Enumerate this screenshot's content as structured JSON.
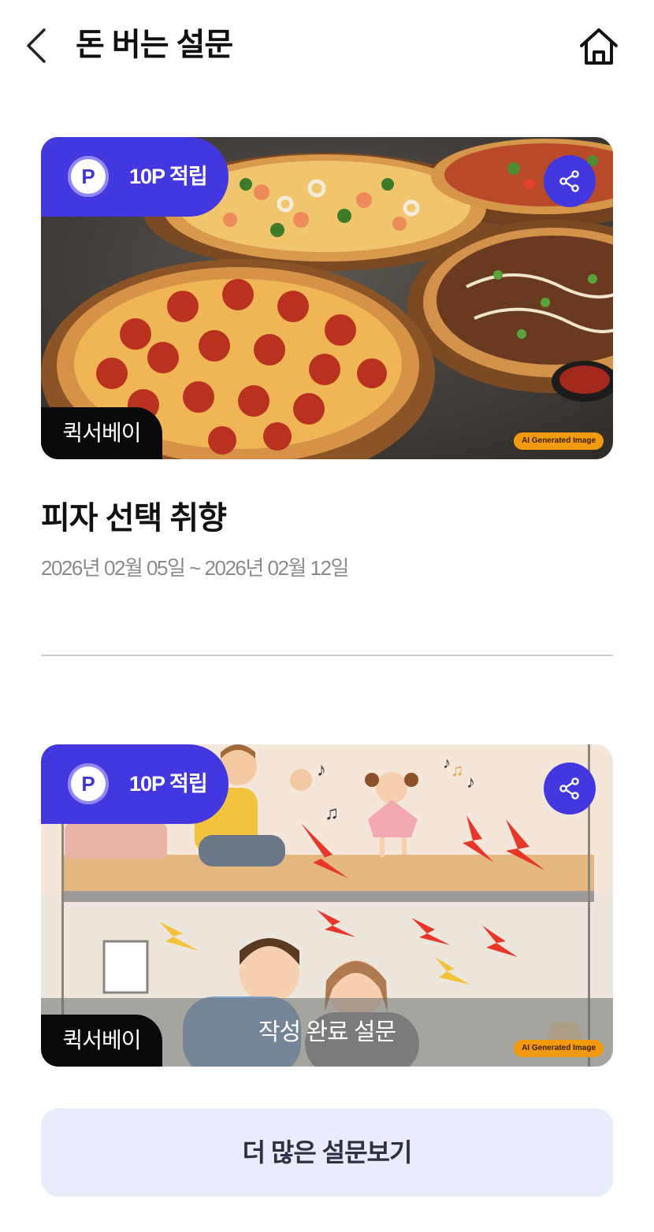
{
  "header": {
    "title": "돈 버는 설문",
    "back_icon": "chevron-left-icon",
    "home_icon": "home-icon"
  },
  "surveys": [
    {
      "point_icon": "P",
      "point_label": "10P 적립",
      "share_icon": "share-icon",
      "brand": "퀵서베이",
      "ai_tag": "AI Generated Image",
      "image_subject": "pizza",
      "title": "피자 선택 취향",
      "period": "2026년 02월 05일 ~ 2026년 02월 12일"
    },
    {
      "point_icon": "P",
      "point_label": "10P 적립",
      "share_icon": "share-icon",
      "brand": "퀵서베이",
      "ai_tag": "AI Generated Image",
      "image_subject": "floor-noise",
      "completed_label": "작성 완료 설문"
    }
  ],
  "more_button": "더 많은 설문보기",
  "colors": {
    "accent": "#4338e0",
    "brand_tag": "#0a0a0a",
    "more_button_bg": "#e8ecfb",
    "ai_tag": "#f29a10"
  }
}
